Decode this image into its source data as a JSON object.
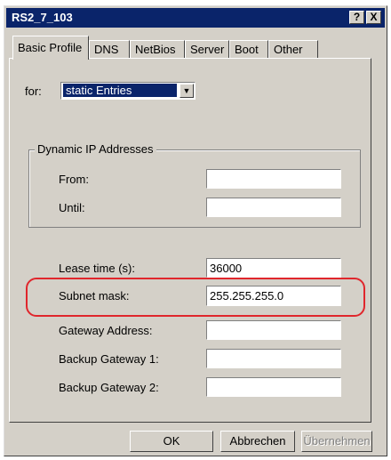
{
  "window": {
    "title": "RS2_7_103",
    "help_label": "?",
    "close_label": "X"
  },
  "tabs": [
    {
      "label": "Basic Profile",
      "active": true
    },
    {
      "label": "DNS"
    },
    {
      "label": "NetBios"
    },
    {
      "label": "Server"
    },
    {
      "label": "Boot"
    },
    {
      "label": "Other"
    }
  ],
  "for_select": {
    "label": "for:",
    "value": "static Entries"
  },
  "dynamic_group": {
    "title": "Dynamic IP Addresses",
    "from_label": "From:",
    "from_value": "",
    "until_label": "Until:",
    "until_value": ""
  },
  "fields": {
    "lease_label": "Lease time (s):",
    "lease_value": "36000",
    "subnet_label": "Subnet mask:",
    "subnet_value": "255.255.255.0",
    "gateway_label": "Gateway Address:",
    "gateway_value": "",
    "backup1_label": "Backup Gateway 1:",
    "backup1_value": "",
    "backup2_label": "Backup Gateway 2:",
    "backup2_value": ""
  },
  "buttons": {
    "ok": "OK",
    "cancel": "Abbrechen",
    "apply": "Übernehmen"
  },
  "colors": {
    "titlebar": "#0a246a",
    "dialog": "#d4d0c8",
    "highlight": "#e0262c"
  }
}
